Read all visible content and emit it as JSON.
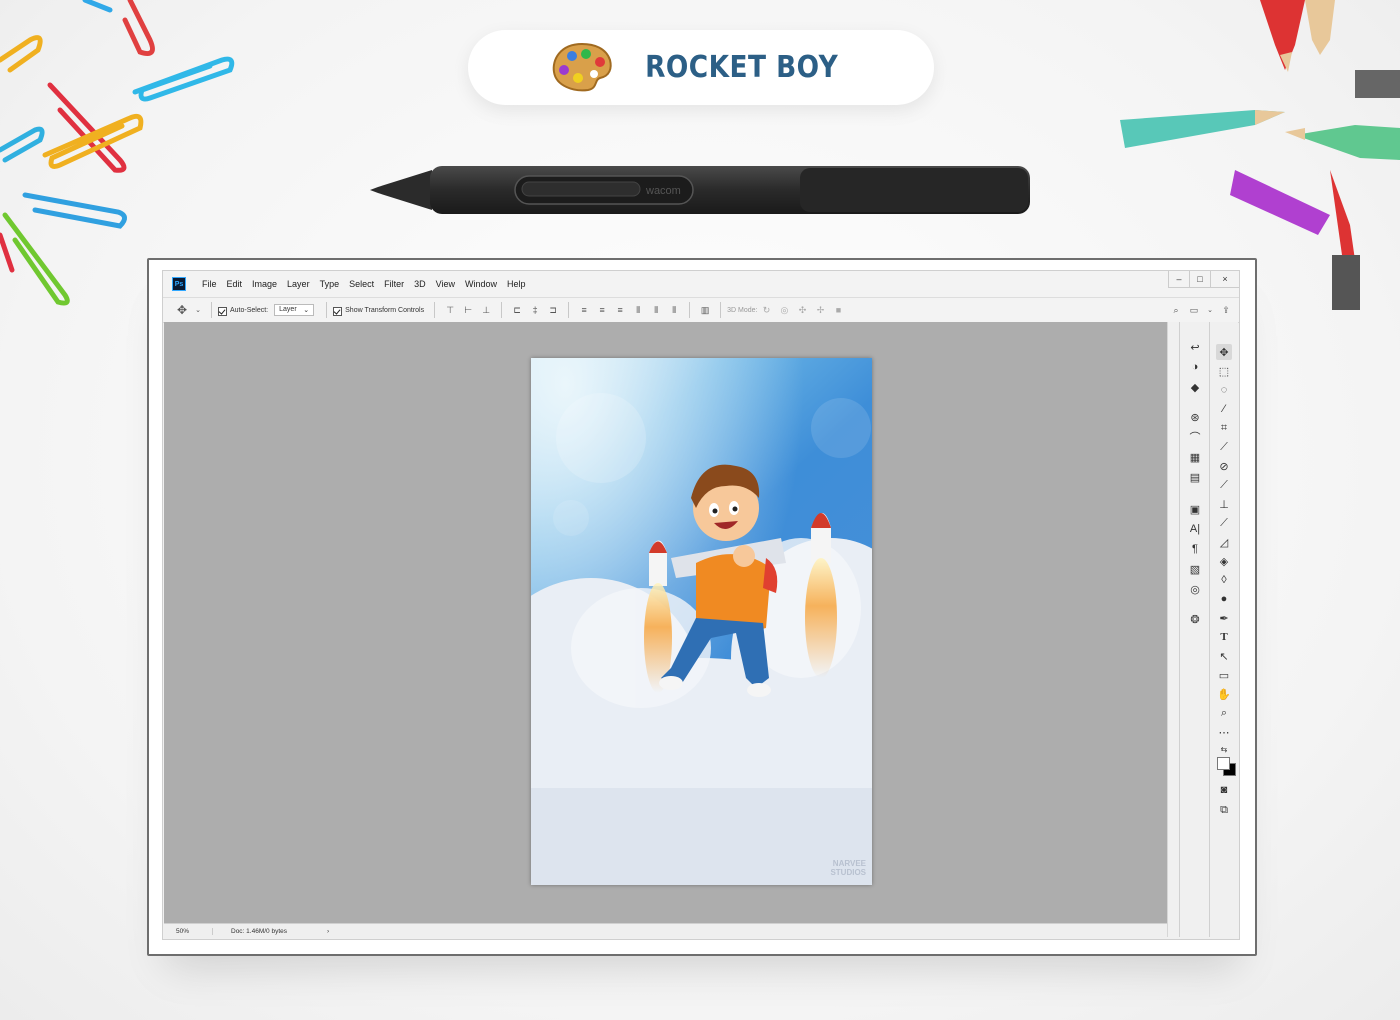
{
  "hero": {
    "title": "ROCKET BOY"
  },
  "app": {
    "menu": [
      "File",
      "Edit",
      "Image",
      "Layer",
      "Type",
      "Select",
      "Filter",
      "3D",
      "View",
      "Window",
      "Help"
    ],
    "window_controls": [
      "–",
      "□",
      "×"
    ],
    "logo_text": "Ps"
  },
  "options": {
    "auto_select_label": "Auto-Select:",
    "auto_select_value": "Layer",
    "show_transform_label": "Show Transform Controls",
    "mode_3d_label": "3D Mode:"
  },
  "status": {
    "zoom": "50%",
    "doc": "Doc: 1.46M/0 bytes",
    "arrow": "›"
  },
  "artwork": {
    "watermark_line1": "NARVEE",
    "watermark_line2": "STUDIOS"
  },
  "colors": {
    "accent": "#2c5f86",
    "sky_top": "#2a78d4",
    "canvas_bg": "#adadad"
  },
  "tools": [
    "move-tool",
    "marquee-tool",
    "lasso-tool",
    "magic-wand-tool",
    "crop-tool",
    "eyedropper-tool",
    "healing-tool",
    "brush-tool",
    "clone-stamp-tool",
    "history-brush-tool",
    "eraser-tool",
    "paint-bucket-tool",
    "blur-tool",
    "dodge-tool",
    "pen-tool",
    "type-tool",
    "path-select-tool",
    "rectangle-tool",
    "hand-tool",
    "zoom-tool",
    "more-tools",
    "swap-colors",
    "color-swatches",
    "quick-mask",
    "screen-mode"
  ],
  "panels": [
    "history-icon",
    "color-icon",
    "layers-icon",
    "3d-icon",
    "paths-icon",
    "grid-icon",
    "adjustments-icon",
    "properties-icon",
    "character-icon",
    "paragraph-icon",
    "notes-icon",
    "libraries-icon",
    "swatches-icon"
  ]
}
